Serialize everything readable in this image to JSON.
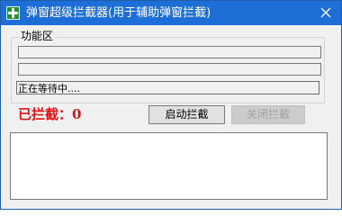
{
  "window": {
    "title": "弹窗超级拦截器(用于辅助弹窗拦截)",
    "icon": "green-plus-app-icon",
    "close_icon": "close-icon"
  },
  "group": {
    "label": "功能区",
    "field1_value": "",
    "field2_value": ""
  },
  "status": {
    "text": "正在等待中...."
  },
  "counter": {
    "text": "已拦截：0"
  },
  "buttons": {
    "start_label": "启动拦截",
    "stop_label": "关闭拦截"
  },
  "log": {
    "content": ""
  },
  "colors": {
    "titlebar": "#1e6ed8",
    "counter": "#e01010",
    "window_bg": "#f0f0f0"
  }
}
